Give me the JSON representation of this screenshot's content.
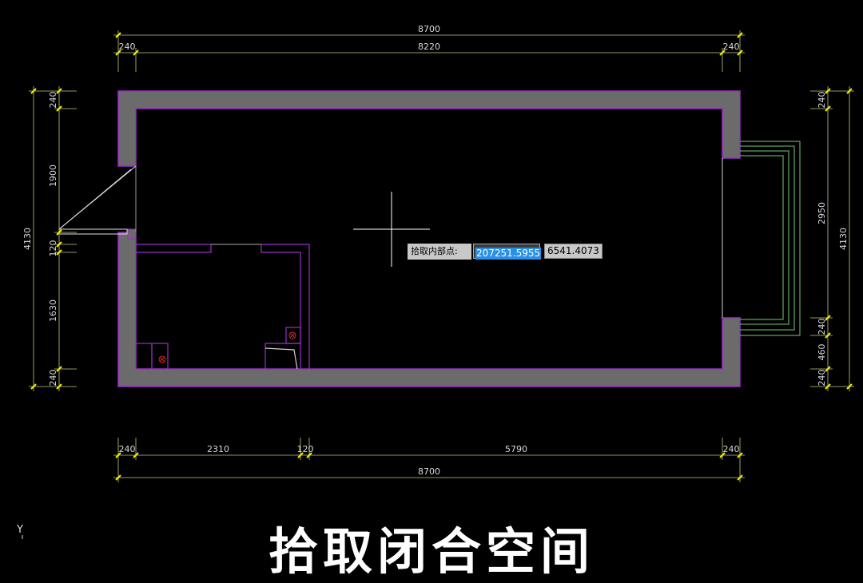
{
  "dimensions": {
    "top_overall": "8700",
    "top_left_wall": "240",
    "top_inner": "8220",
    "top_right_wall": "240",
    "left_overall": "4130",
    "left_top_wall": "240",
    "left_upper": "1900",
    "left_mid": "120",
    "left_lower": "1630",
    "left_bottom_wall": "240",
    "right_overall": "4130",
    "right_top_wall": "240",
    "right_window": "2950",
    "right_mid_wall": "240",
    "right_gap": "460",
    "right_bottom_wall": "240",
    "bottom_left_wall": "240",
    "bottom_room": "2310",
    "bottom_partition": "120",
    "bottom_main": "5790",
    "bottom_right_wall": "240",
    "bottom_overall": "8700"
  },
  "prompt": {
    "label": "拾取内部点:",
    "x_value": "207251.5955",
    "y_value": "6541.4073"
  },
  "ucs_label": "Y",
  "caption": "拾取闭合空间",
  "colors": {
    "background": "#000000",
    "wall_fill": "#6b6b6b",
    "wall_outline": "#9b2ec8",
    "dimension_line": "#c9c97a",
    "dimension_tick": "#f0f000",
    "window_line": "#79c879",
    "text": "#d8d8d8",
    "highlight": "#2a8fe6"
  }
}
